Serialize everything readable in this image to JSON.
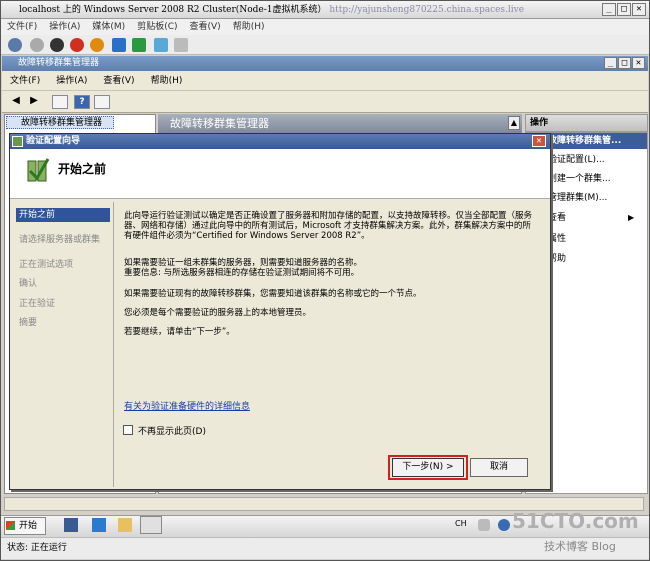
{
  "vm": {
    "title": "localhost 上的 Windows Server 2008 R2 Cluster(Node-1虚拟机系统）",
    "watermark_url": "http://yajunsheng870225.china.spaces.live",
    "menu": [
      "文件(F)",
      "操作(A)",
      "媒体(M)",
      "剪贴板(C)",
      "查看(V)",
      "帮助(H)"
    ]
  },
  "manager": {
    "title": "故障转移群集管理器",
    "menu": [
      "文件(F)",
      "操作(A)",
      "查看(V)",
      "帮助(H)"
    ],
    "tree_root": "故障转移群集管理器",
    "center_header": "故障转移群集管理器"
  },
  "actions": {
    "header": "操作",
    "selected": "故障转移群集管...",
    "items": [
      "验证配置(L)...",
      "创建一个群集...",
      "管理群集(M)...",
      "查看",
      "属性",
      "帮助"
    ]
  },
  "wizard": {
    "window_title": "验证配置向导",
    "heading": "开始之前",
    "nav": [
      "开始之前",
      "请选择服务器或群集",
      "正在测试选项",
      "确认",
      "正在验证",
      "摘要"
    ],
    "paragraphs": [
      "此向导运行验证测试以确定是否正确设置了服务器和附加存储的配置，以支持故障转移。仅当全部配置（服务器、网络和存储）通过此向导中的所有测试后，Microsoft 才支持群集解决方案。此外，群集解决方案中的所有硬件组件必须为“Certified for Windows Server 2008 R2”。",
      "如果需要验证一组未群集的服务器，则需要知道服务器的名称。",
      "重要信息: 与所选服务器相连的存储在验证测试期间将不可用。",
      "如果需要验证现有的故障转移群集，您需要知道该群集的名称或它的一个节点。",
      "您必须是每个需要验证的服务器上的本地管理员。",
      "若要继续，请单击“下一步”。"
    ],
    "link": "有关为验证准备硬件的详细信息",
    "checkbox_label": "不再显示此页(D)",
    "next_button": "下一步(N) >",
    "cancel_button": "取消"
  },
  "taskbar": {
    "start": "开始",
    "lang": "CH"
  },
  "status": {
    "text": "状态:  正在运行"
  },
  "watermarks": {
    "site": "51CTO.com",
    "blog": "技术博客  Blog"
  }
}
